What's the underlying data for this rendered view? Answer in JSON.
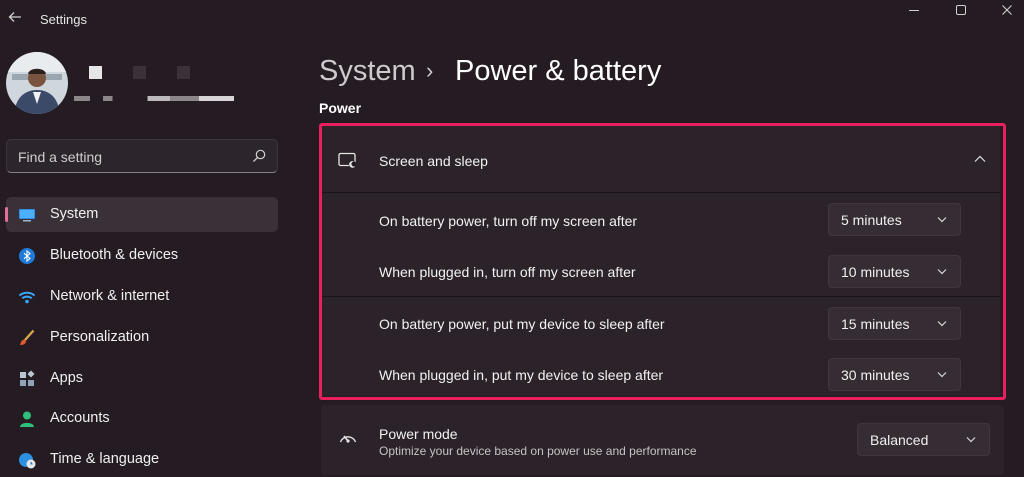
{
  "window": {
    "title": "Settings"
  },
  "search": {
    "placeholder": "Find a setting"
  },
  "sidebar": {
    "items": [
      {
        "label": "System",
        "active": true
      },
      {
        "label": "Bluetooth & devices"
      },
      {
        "label": "Network & internet"
      },
      {
        "label": "Personalization"
      },
      {
        "label": "Apps"
      },
      {
        "label": "Accounts"
      },
      {
        "label": "Time & language"
      }
    ]
  },
  "header": {
    "breadcrumb_parent": "System",
    "separator": "›",
    "title": "Power & battery"
  },
  "section": {
    "title": "Power"
  },
  "screen_sleep": {
    "title": "Screen and sleep",
    "rows": [
      {
        "label": "On battery power, turn off my screen after",
        "value": "5 minutes"
      },
      {
        "label": "When plugged in, turn off my screen after",
        "value": "10 minutes"
      },
      {
        "label": "On battery power, put my device to sleep after",
        "value": "15 minutes"
      },
      {
        "label": "When plugged in, put my device to sleep after",
        "value": "30 minutes"
      }
    ]
  },
  "power_mode": {
    "title": "Power mode",
    "description": "Optimize your device based on power use and performance",
    "value": "Balanced"
  },
  "colors": {
    "accent": "#e0709a",
    "highlight_border": "#ea1f5e",
    "background": "#241c22",
    "card": "#2b2329"
  }
}
